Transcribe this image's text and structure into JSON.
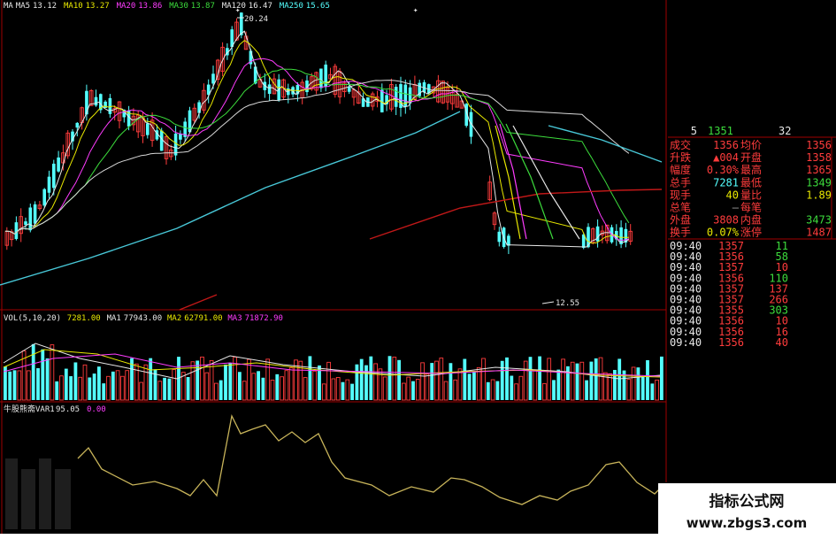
{
  "colors": {
    "bg": "#000000",
    "red": "#ff3c3c",
    "cyan": "#54ffff",
    "white": "#e8e8e8",
    "yellow": "#e8e800",
    "magenta": "#ff3cff",
    "green": "#3cdc3c",
    "gray": "#a0a0a0",
    "border": "#a00000",
    "osc": "#c8b45a"
  },
  "main_panel": {
    "ma_legend": [
      {
        "label": "MA",
        "value": "",
        "color": "#e8e8e8"
      },
      {
        "label": "MA5",
        "value": "13.12",
        "color": "#e8e8e8"
      },
      {
        "label": "MA10",
        "value": "13.27",
        "color": "#e8e800"
      },
      {
        "label": "MA20",
        "value": "13.86",
        "color": "#ff3cff"
      },
      {
        "label": "MA30",
        "value": "13.87",
        "color": "#3cdc3c"
      },
      {
        "label": "MA120",
        "value": "16.47",
        "color": "#e8e8e8"
      },
      {
        "label": "MA250",
        "value": "15.65",
        "color": "#54ffff"
      }
    ],
    "high_label": "20.24",
    "low_label": "12.55"
  },
  "volume_panel": {
    "legend": [
      {
        "label": "VOL(5,10,20)",
        "color": "#e8e8e8"
      },
      {
        "label": "7281.00",
        "color": "#e8e800"
      },
      {
        "label": "MA1",
        "value": "77943.00",
        "color": "#e8e8e8"
      },
      {
        "label": "MA2",
        "value": "62791.00",
        "color": "#e8e800"
      },
      {
        "label": "MA3",
        "value": "71872.90",
        "color": "#ff3cff"
      }
    ]
  },
  "indicator_panel": {
    "legend": [
      {
        "label": "牛股熊斋VAR1",
        "value": "95.05",
        "color": "#e8e8e8"
      },
      {
        "label": "0.00",
        "color": "#ff3cff"
      }
    ]
  },
  "quote_panel": {
    "top_row": {
      "col1": "5",
      "col2": "1351",
      "col3": "32"
    },
    "rows": [
      {
        "l_label": "成交",
        "l_value": "1356",
        "r_label": "均价",
        "r_value": "1356",
        "l_color": "#ff3c3c",
        "r_color": "#ff3c3c"
      },
      {
        "l_label": "升跌",
        "l_value": "▲004",
        "r_label": "开盘",
        "r_value": "1358",
        "l_color": "#ff3c3c",
        "r_color": "#ff3c3c"
      },
      {
        "l_label": "幅度",
        "l_value": "0.30%",
        "r_label": "最高",
        "r_value": "1365",
        "l_color": "#ff3c3c",
        "r_color": "#ff3c3c"
      },
      {
        "l_label": "总手",
        "l_value": "7281",
        "r_label": "最低",
        "r_value": "1349",
        "l_color": "#54ffff",
        "r_color": "#3cdc3c"
      },
      {
        "l_label": "现手",
        "l_value": "40",
        "r_label": "量比",
        "r_value": "1.89",
        "l_color": "#e8e800",
        "r_color": "#e8e800"
      },
      {
        "l_label": "总笔",
        "l_value": "—",
        "r_label": "每笔",
        "r_value": "",
        "l_color": "#a0a0a0",
        "r_color": "#a0a0a0"
      },
      {
        "l_label": "外盘",
        "l_value": "3808",
        "r_label": "内盘",
        "r_value": "3473",
        "l_color": "#ff3c3c",
        "r_color": "#3cdc3c"
      },
      {
        "l_label": "换手",
        "l_value": "0.07%",
        "r_label": "涨停",
        "r_value": "1487",
        "l_color": "#e8e800",
        "r_color": "#ff3c3c"
      }
    ],
    "ticks": [
      {
        "time": "09:40",
        "price": "1357",
        "vol": "11",
        "vcolor": "#3cdc3c"
      },
      {
        "time": "09:40",
        "price": "1356",
        "vol": "58",
        "vcolor": "#3cdc3c"
      },
      {
        "time": "09:40",
        "price": "1357",
        "vol": "10",
        "vcolor": "#ff3c3c"
      },
      {
        "time": "09:40",
        "price": "1356",
        "vol": "110",
        "vcolor": "#3cdc3c"
      },
      {
        "time": "09:40",
        "price": "1357",
        "vol": "137",
        "vcolor": "#ff3c3c"
      },
      {
        "time": "09:40",
        "price": "1357",
        "vol": "266",
        "vcolor": "#ff3c3c"
      },
      {
        "time": "09:40",
        "price": "1355",
        "vol": "303",
        "vcolor": "#3cdc3c"
      },
      {
        "time": "09:40",
        "price": "1356",
        "vol": "10",
        "vcolor": "#ff3c3c"
      },
      {
        "time": "09:40",
        "price": "1356",
        "vol": "16",
        "vcolor": "#ff3c3c"
      },
      {
        "time": "09:40",
        "price": "1356",
        "vol": "40",
        "vcolor": "#ff3c3c"
      }
    ]
  },
  "watermark": {
    "title": "指标公式网",
    "url": "www.zbgs3.com"
  }
}
